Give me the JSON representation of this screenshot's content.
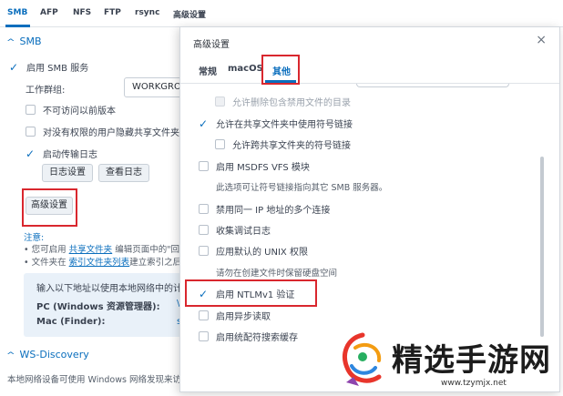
{
  "protocol_tabs": [
    "SMB",
    "AFP",
    "NFS",
    "FTP",
    "rsync",
    "高级设置"
  ],
  "smb": {
    "section_title": "SMB",
    "enable_label": "启用 SMB 服务",
    "workgroup_label": "工作群组:",
    "workgroup_value": "WORKGROUP",
    "hide_inaccessible_label": "不可访问以前版本",
    "hide_no_permission_label": "对没有权限的用户隐藏共享文件夹",
    "transfer_log_label": "启动传输日志",
    "log_settings_button": "日志设置",
    "view_logs_button": "查看日志",
    "advanced_button": "高级设置",
    "notes_title": "注意:",
    "note1_prefix": "• 您可启用 ",
    "note1_link": "共享文件夹",
    "note1_suffix": " 编辑页面中的\"回收",
    "note2_prefix": "• 文件夹在 ",
    "note2_link": "索引文件夹列表",
    "note2_suffix": "建立索引之后,",
    "info_intro": "输入以下地址以使用本地网络中的计算机",
    "info_pc_label": "PC (Windows 资源管理器):",
    "info_mac_label": "Mac (Finder):",
    "info_pc_value": "\\",
    "info_mac_value": "s"
  },
  "ws_discovery": {
    "section_title": "WS-Discovery",
    "description": "本地网络设备可使用 Windows 网络发现来访问"
  },
  "dialog": {
    "title": "高级设置",
    "close_symbol": "×",
    "tabs": [
      "常规",
      "macOS",
      "其他"
    ],
    "items": [
      {
        "label": "允许删除包含禁用文件的目录"
      },
      {
        "label": "允许在共享文件夹中使用符号链接"
      },
      {
        "label": "允许跨共享文件夹的符号链接"
      },
      {
        "label": "启用 MSDFS VFS 模块"
      },
      {
        "hint": "此选项可让符号链接指向其它 SMB 服务器。"
      },
      {
        "label": "禁用同一 IP 地址的多个连接"
      },
      {
        "label": "收集调试日志"
      },
      {
        "label": "应用默认的 UNIX 权限"
      },
      {
        "label": "请勿在创建文件时保留硬盘空间"
      },
      {
        "label": "启用 NTLMv1 验证"
      },
      {
        "label": "启用异步读取"
      },
      {
        "label": "启用统配符搜索缓存"
      }
    ]
  },
  "watermark": {
    "text": "精选手游网",
    "url": "www.tzymjx.net"
  },
  "colors": {
    "accent": "#0a6ebd",
    "highlight_border": "#d9272e",
    "info_bg": "#e9f1f9"
  }
}
